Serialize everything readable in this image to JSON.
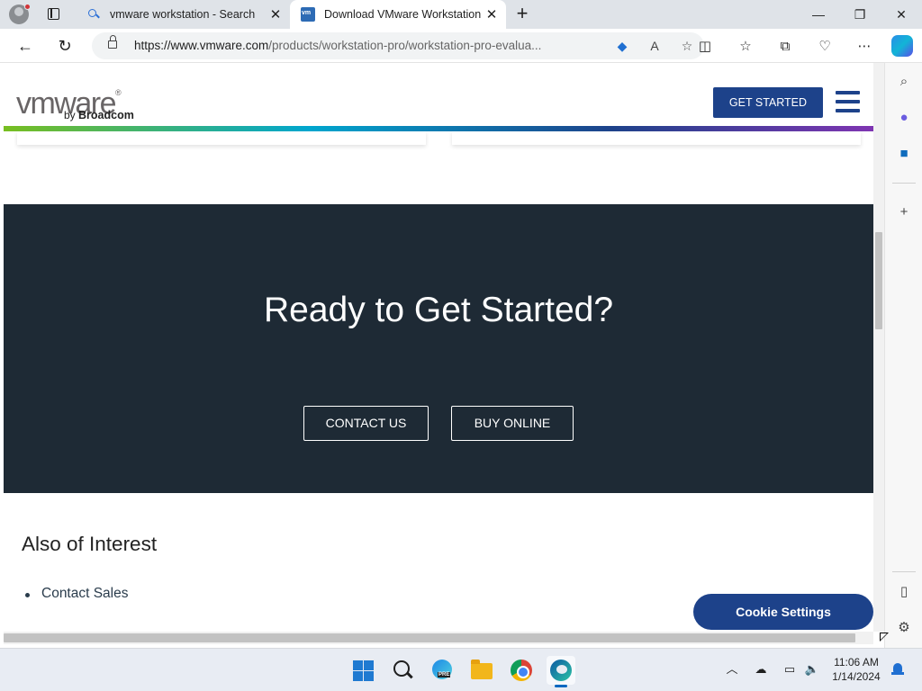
{
  "browser": {
    "tabs": [
      {
        "title": "vmware workstation - Search",
        "favicon": "search-icon",
        "active": false
      },
      {
        "title": "Download VMware Workstation",
        "favicon": "vmware-favicon",
        "active": true
      }
    ],
    "url_host": "https://www.vmware.com",
    "url_path": "/products/workstation-pro/workstation-pro-evalua...",
    "window_controls": {
      "minimize": "—",
      "maximize": "❐",
      "close": "✕"
    }
  },
  "page": {
    "logo": {
      "wordmark": "vmware",
      "trademark": "®",
      "by": "by",
      "company": "Broadcom"
    },
    "header": {
      "cta": "GET STARTED"
    },
    "hero": {
      "title": "Ready to Get Started?",
      "buttons": {
        "contact": "CONTACT US",
        "buy": "BUY ONLINE"
      }
    },
    "interest": {
      "title": "Also of Interest",
      "items": [
        "Contact Sales"
      ]
    },
    "cookie_button": "Cookie Settings"
  },
  "taskbar": {
    "time": "11:06 AM",
    "date": "1/14/2024",
    "apps": [
      "start-icon",
      "search-icon",
      "edge-beta-icon",
      "file-explorer-icon",
      "chrome-icon",
      "edge-icon"
    ]
  },
  "colors": {
    "brand_blue": "#1d428a",
    "hero_bg": "#1e2a35"
  }
}
